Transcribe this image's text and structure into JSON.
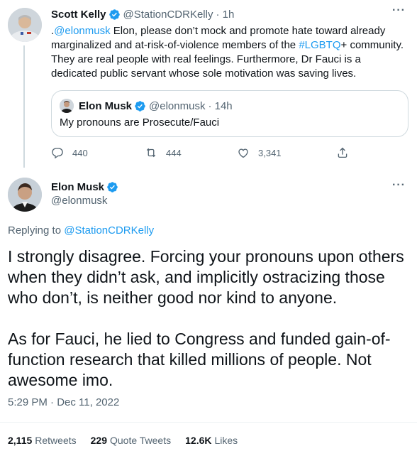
{
  "colors": {
    "accent": "#1d9bf0",
    "muted": "#536471",
    "text": "#0f1419",
    "border": "#cfd9de"
  },
  "parent_tweet": {
    "author_name": "Scott Kelly",
    "author_handle": "@StationCDRKelly",
    "time": "· 1h",
    "more": "···",
    "text_prefix": ".",
    "mention": "@elonmusk",
    "text_part1": " Elon, please don’t mock and promote hate toward already marginalized and at-risk-of-violence members of the ",
    "hashtag": "#LGBTQ",
    "text_part2": "+ community. They are real people with real feelings. Furthermore, Dr Fauci is a dedicated public servant whose sole motivation was saving lives.",
    "quoted": {
      "author_name": "Elon Musk",
      "author_handle": "@elonmusk",
      "time": "· 14h",
      "text": "My pronouns are Prosecute/Fauci"
    },
    "actions": {
      "replies": "440",
      "retweets": "444",
      "likes": "3,341"
    },
    "icons": [
      "reply-icon",
      "retweet-icon",
      "like-icon",
      "share-icon",
      "verified-badge-icon"
    ]
  },
  "main_tweet": {
    "author_name": "Elon Musk",
    "author_handle": "@elonmusk",
    "more": "···",
    "replying_prefix": "Replying to ",
    "replying_to": "@StationCDRKelly",
    "paragraph1": "I strongly disagree. Forcing your pronouns upon others when they didn’t ask, and implicitly ostracizing those who don’t, is neither good nor kind to anyone.",
    "paragraph2": "As for Fauci, he lied to Congress and funded gain-of-function research that killed millions of people. Not awesome imo.",
    "timestamp": "5:29 PM · Dec 11, 2022",
    "stats": {
      "retweets_count": "2,115",
      "retweets_label": "Retweets",
      "quotes_count": "229",
      "quotes_label": "Quote Tweets",
      "likes_count": "12.6K",
      "likes_label": "Likes"
    }
  }
}
